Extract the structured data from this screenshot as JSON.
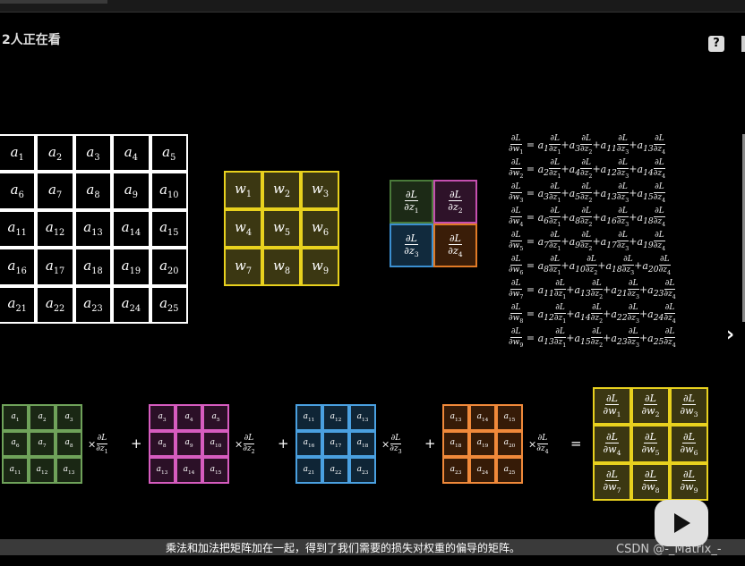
{
  "header": {
    "watching": "2人正在看",
    "help_icon": "?"
  },
  "matrix_a": [
    [
      "a",
      "1"
    ],
    [
      "a",
      "2"
    ],
    [
      "a",
      "3"
    ],
    [
      "a",
      "4"
    ],
    [
      "a",
      "5"
    ],
    [
      "a",
      "6"
    ],
    [
      "a",
      "7"
    ],
    [
      "a",
      "8"
    ],
    [
      "a",
      "9"
    ],
    [
      "a",
      "10"
    ],
    [
      "a",
      "11"
    ],
    [
      "a",
      "12"
    ],
    [
      "a",
      "13"
    ],
    [
      "a",
      "14"
    ],
    [
      "a",
      "15"
    ],
    [
      "a",
      "16"
    ],
    [
      "a",
      "17"
    ],
    [
      "a",
      "18"
    ],
    [
      "a",
      "19"
    ],
    [
      "a",
      "20"
    ],
    [
      "a",
      "21"
    ],
    [
      "a",
      "22"
    ],
    [
      "a",
      "23"
    ],
    [
      "a",
      "24"
    ],
    [
      "a",
      "25"
    ]
  ],
  "matrix_w": [
    [
      "w",
      "1"
    ],
    [
      "w",
      "2"
    ],
    [
      "w",
      "3"
    ],
    [
      "w",
      "4"
    ],
    [
      "w",
      "5"
    ],
    [
      "w",
      "6"
    ],
    [
      "w",
      "7"
    ],
    [
      "w",
      "8"
    ],
    [
      "w",
      "9"
    ]
  ],
  "grad_z": [
    {
      "n": "∂L",
      "d": "∂z",
      "s": "1",
      "color": "#4a7a3a",
      "bg": "#1c2a16"
    },
    {
      "n": "∂L",
      "d": "∂z",
      "s": "2",
      "color": "#c54fb0",
      "bg": "#2e1229"
    },
    {
      "n": "∂L",
      "d": "∂z",
      "s": "3",
      "color": "#3b8fd0",
      "bg": "#112a3d"
    },
    {
      "n": "∂L",
      "d": "∂z",
      "s": "4",
      "color": "#e07a26",
      "bg": "#3a1d08"
    }
  ],
  "equations": [
    {
      "w": "1",
      "terms": [
        [
          "a",
          "1",
          "1"
        ],
        [
          "a",
          "3",
          "2"
        ],
        [
          "a",
          "11",
          "3"
        ],
        [
          "a",
          "13",
          "4"
        ]
      ]
    },
    {
      "w": "2",
      "terms": [
        [
          "a",
          "2",
          "1"
        ],
        [
          "a",
          "4",
          "2"
        ],
        [
          "a",
          "12",
          "3"
        ],
        [
          "a",
          "14",
          "4"
        ]
      ]
    },
    {
      "w": "3",
      "terms": [
        [
          "a",
          "3",
          "1"
        ],
        [
          "a",
          "5",
          "2"
        ],
        [
          "a",
          "13",
          "3"
        ],
        [
          "a",
          "15",
          "4"
        ]
      ]
    },
    {
      "w": "4",
      "terms": [
        [
          "a",
          "6",
          "1"
        ],
        [
          "a",
          "8",
          "2"
        ],
        [
          "a",
          "16",
          "3"
        ],
        [
          "a",
          "18",
          "4"
        ]
      ]
    },
    {
      "w": "5",
      "terms": [
        [
          "a",
          "7",
          "1"
        ],
        [
          "a",
          "9",
          "2"
        ],
        [
          "a",
          "17",
          "3"
        ],
        [
          "a",
          "19",
          "4"
        ]
      ]
    },
    {
      "w": "6",
      "terms": [
        [
          "a",
          "8",
          "1"
        ],
        [
          "a",
          "10",
          "2"
        ],
        [
          "a",
          "18",
          "3"
        ],
        [
          "a",
          "20",
          "4"
        ]
      ]
    },
    {
      "w": "7",
      "terms": [
        [
          "a",
          "11",
          "1"
        ],
        [
          "a",
          "13",
          "2"
        ],
        [
          "a",
          "21",
          "3"
        ],
        [
          "a",
          "23",
          "4"
        ]
      ]
    },
    {
      "w": "8",
      "terms": [
        [
          "a",
          "12",
          "1"
        ],
        [
          "a",
          "14",
          "2"
        ],
        [
          "a",
          "22",
          "3"
        ],
        [
          "a",
          "24",
          "4"
        ]
      ]
    },
    {
      "w": "9",
      "terms": [
        [
          "a",
          "13",
          "1"
        ],
        [
          "a",
          "15",
          "2"
        ],
        [
          "a",
          "23",
          "3"
        ],
        [
          "a",
          "25",
          "4"
        ]
      ]
    }
  ],
  "bottom_patches": [
    {
      "color": "#6fa25a",
      "bg": "#1a2714",
      "cells": [
        "1",
        "2",
        "3",
        "6",
        "7",
        "8",
        "11",
        "12",
        "13"
      ],
      "z": "1"
    },
    {
      "color": "#d65cbf",
      "bg": "#2b1027",
      "cells": [
        "3",
        "4",
        "5",
        "8",
        "9",
        "10",
        "13",
        "14",
        "15"
      ],
      "z": "2"
    },
    {
      "color": "#4aa0e0",
      "bg": "#0f2536",
      "cells": [
        "11",
        "12",
        "13",
        "16",
        "17",
        "18",
        "21",
        "22",
        "23"
      ],
      "z": "3"
    },
    {
      "color": "#f0893a",
      "bg": "#361b07",
      "cells": [
        "13",
        "14",
        "15",
        "18",
        "19",
        "20",
        "23",
        "24",
        "25"
      ],
      "z": "4"
    }
  ],
  "operators": {
    "times": "×",
    "plus": "+",
    "equals": "="
  },
  "result_grid": [
    [
      "w",
      "1"
    ],
    [
      "w",
      "2"
    ],
    [
      "w",
      "3"
    ],
    [
      "w",
      "4"
    ],
    [
      "w",
      "5"
    ],
    [
      "w",
      "6"
    ],
    [
      "w",
      "7"
    ],
    [
      "w",
      "8"
    ],
    [
      "w",
      "9"
    ]
  ],
  "subtitle": "乘法和加法把矩阵加在一起，得到了我们需要的损失对权重的偏导的矩阵。",
  "watermark": "CSDN @-_Matrix_-",
  "colors": {
    "background": "#000000",
    "a_grid": "#ffffff",
    "w_grid": "#e8d11e"
  }
}
